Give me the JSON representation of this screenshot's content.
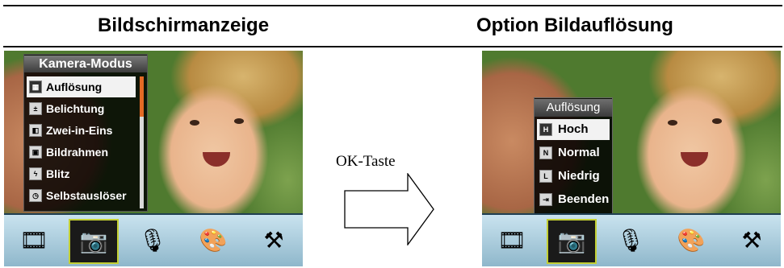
{
  "headers": {
    "left": "Bildschirmanzeige",
    "right": "Option Bildauflösung"
  },
  "left_screen": {
    "menu_title": "Kamera-Modus",
    "items": [
      {
        "label": "Auflösung",
        "selected": true,
        "icon": "resolution-icon"
      },
      {
        "label": "Belichtung",
        "selected": false,
        "icon": "exposure-icon"
      },
      {
        "label": "Zwei-in-Eins",
        "selected": false,
        "icon": "two-in-one-icon"
      },
      {
        "label": "Bildrahmen",
        "selected": false,
        "icon": "frame-icon"
      },
      {
        "label": "Blitz",
        "selected": false,
        "icon": "flash-icon"
      },
      {
        "label": "Selbstauslöser",
        "selected": false,
        "icon": "self-timer-icon"
      }
    ]
  },
  "right_screen": {
    "submenu_title": "Auflösung",
    "items": [
      {
        "label": "Hoch",
        "selected": true,
        "icon": "high-icon"
      },
      {
        "label": "Normal",
        "selected": false,
        "icon": "normal-icon"
      },
      {
        "label": "Niedrig",
        "selected": false,
        "icon": "low-icon"
      },
      {
        "label": "Beenden",
        "selected": false,
        "icon": "exit-icon"
      }
    ]
  },
  "iconbar": [
    {
      "name": "video-mode-icon",
      "glyph": "🎞",
      "active": false
    },
    {
      "name": "camera-mode-icon",
      "glyph": "📷",
      "active": true
    },
    {
      "name": "microphone-icon",
      "glyph": "🎙",
      "active": false
    },
    {
      "name": "palette-icon",
      "glyph": "🎨",
      "active": false
    },
    {
      "name": "tools-icon",
      "glyph": "⚒",
      "active": false
    }
  ],
  "transition_label": "OK-Taste",
  "colors": {
    "selection_highlight": "#f2f2f2",
    "scroll_thumb": "#e36a25",
    "active_icon_border": "#c3cf34"
  }
}
